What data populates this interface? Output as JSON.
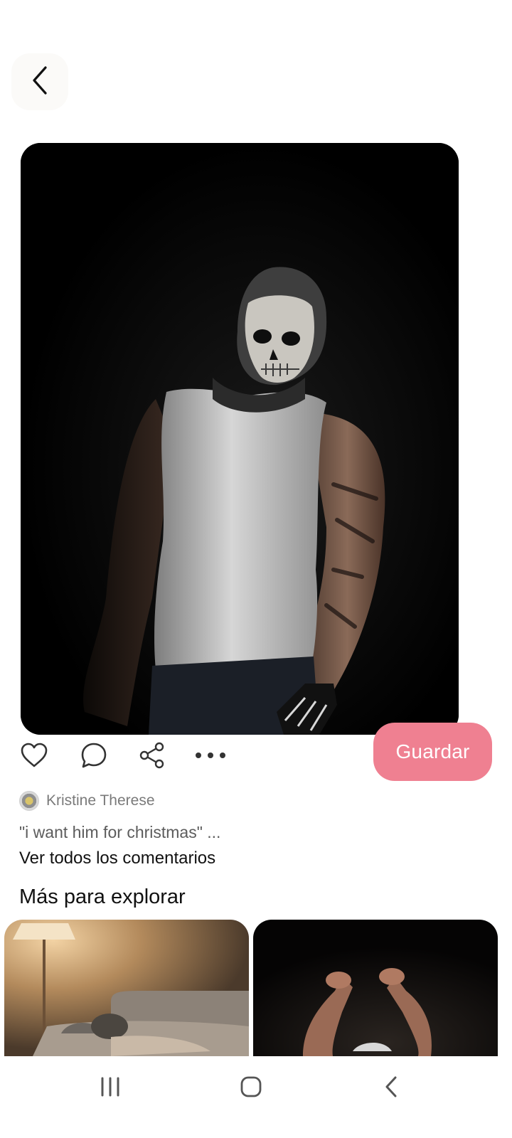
{
  "header": {
    "back_icon": "chevron-left-icon"
  },
  "pin": {
    "image_alt": "Man in white tank top wearing a skull mask with tattooed arm on dark background",
    "save_label": "Guardar",
    "actions": [
      "heart-icon",
      "comment-icon",
      "share-icon",
      "more-icon"
    ]
  },
  "author": {
    "name": "Kristine Therese"
  },
  "comments": {
    "preview": "\"i want him for christmas\" ...",
    "see_all": "Ver todos los comentarios"
  },
  "explore": {
    "title": "Más para explorar"
  },
  "colors": {
    "save_button": "#ef8091",
    "background": "#ffffff"
  },
  "system_nav": [
    "recent-apps-icon",
    "home-icon",
    "back-icon"
  ]
}
